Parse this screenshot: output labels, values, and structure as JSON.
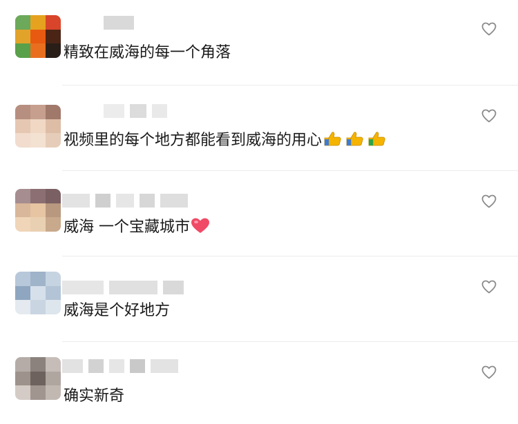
{
  "comments": [
    {
      "text": "精致在威海的每一个角落",
      "emoji": "",
      "emoji_name": ""
    },
    {
      "text": "视频里的每个地方都能看到威海的用心",
      "emoji": "👍👍👍",
      "emoji_name": "thumbs-up-icon"
    },
    {
      "text": "威海 一个宝藏城市",
      "emoji": "❤",
      "emoji_name": "heart-emoji-icon"
    },
    {
      "text": "威海是个好地方",
      "emoji": "",
      "emoji_name": ""
    },
    {
      "text": "确实新奇",
      "emoji": "",
      "emoji_name": ""
    }
  ],
  "like_icon": "heart-outline-icon",
  "colors": {
    "text": "#1a1a1a",
    "heart_outline": "#8a8a8a",
    "heart_emoji": "#f04a66",
    "thumb": "#f4b400"
  }
}
